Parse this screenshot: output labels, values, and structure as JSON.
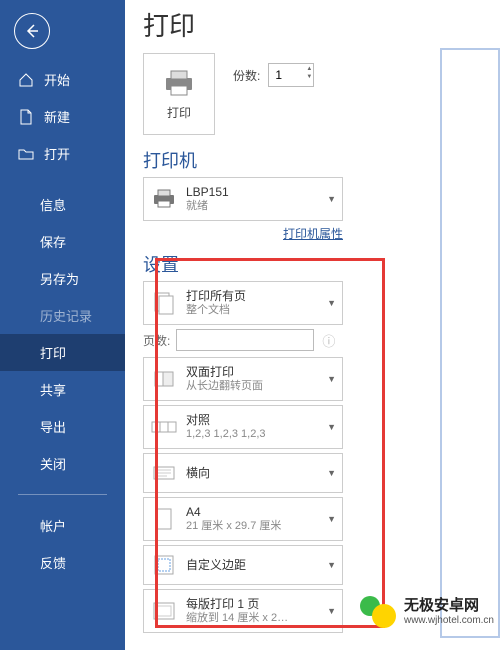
{
  "colors": {
    "brand": "#2b579a",
    "highlight": "#e53935"
  },
  "sidebar": {
    "home": "开始",
    "new": "新建",
    "open": "打开",
    "info": "信息",
    "save": "保存",
    "saveas": "另存为",
    "history": "历史记录",
    "print": "打印",
    "share": "共享",
    "export": "导出",
    "close": "关闭",
    "account": "帐户",
    "feedback": "反馈"
  },
  "page": {
    "title": "打印",
    "print_btn": "打印",
    "copies_label": "份数:",
    "copies_value": "1"
  },
  "printer": {
    "heading": "打印机",
    "name": "LBP151",
    "status": "就绪",
    "props_link": "打印机属性"
  },
  "settings": {
    "heading": "设置",
    "pages_label": "页数:",
    "items": [
      {
        "title": "打印所有页",
        "sub": "整个文档"
      },
      {
        "title": "双面打印",
        "sub": "从长边翻转页面"
      },
      {
        "title": "对照",
        "sub": "1,2,3    1,2,3    1,2,3"
      },
      {
        "title": "横向",
        "sub": ""
      },
      {
        "title": "A4",
        "sub": "21 厘米 x 29.7 厘米"
      },
      {
        "title": "自定义边距",
        "sub": ""
      },
      {
        "title": "每版打印 1 页",
        "sub": "缩放到 14 厘米 x 2…"
      }
    ]
  },
  "watermark": {
    "brand": "无极安卓网",
    "url": "www.wjhotel.com.cn"
  }
}
